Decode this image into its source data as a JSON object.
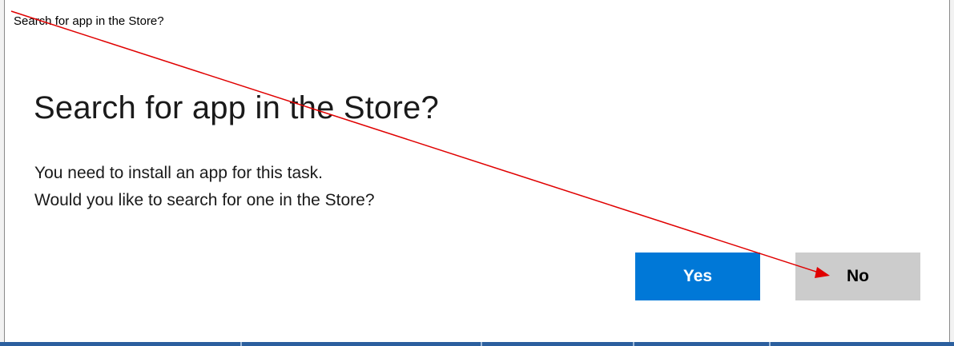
{
  "window": {
    "title": "Search for app in the Store?"
  },
  "dialog": {
    "heading": "Search for app in the Store?",
    "message_lines": [
      "You need to install an app for this task.",
      "Would you like to search for one in the Store?"
    ],
    "buttons": {
      "yes_label": "Yes",
      "no_label": "No"
    }
  },
  "colors": {
    "accent": "#0078d7",
    "secondary_button": "#cccccc",
    "annotation_arrow": "#e00000",
    "taskbar": "#2b5f9e"
  },
  "annotation": {
    "type": "arrow",
    "points_to": "no-button"
  }
}
